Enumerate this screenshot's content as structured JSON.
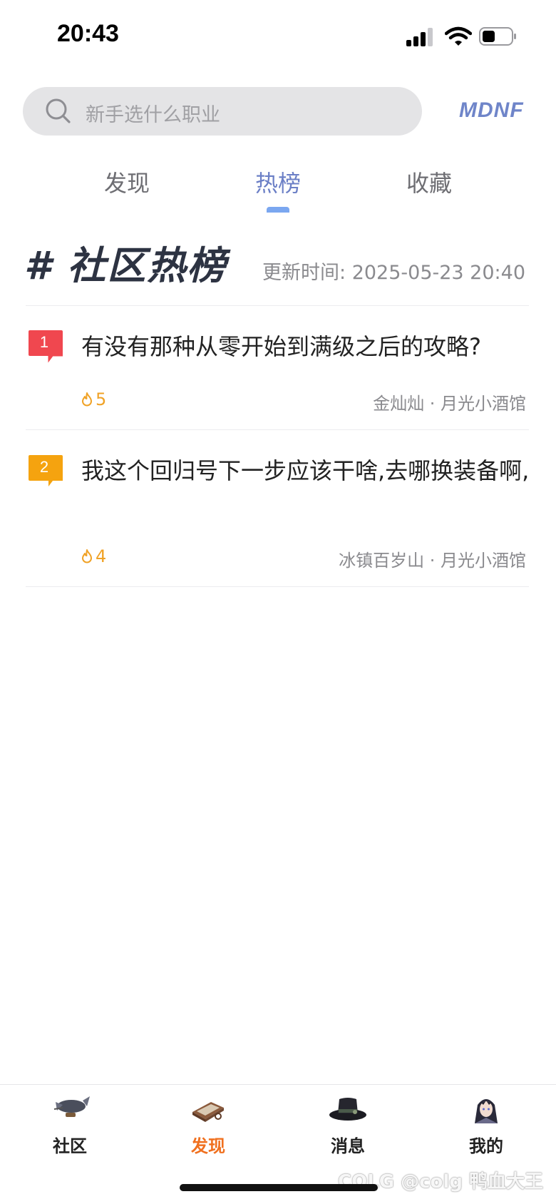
{
  "status_bar": {
    "time": "20:43",
    "icons": [
      "signal-icon",
      "wifi-icon",
      "battery-icon"
    ]
  },
  "search": {
    "placeholder": "新手选什么职业",
    "icon": "search-icon"
  },
  "brand": {
    "logo_text": "MDNF"
  },
  "tabs": [
    {
      "label": "发现",
      "active": false
    },
    {
      "label": "热榜",
      "active": true
    },
    {
      "label": "收藏",
      "active": false
    }
  ],
  "hot": {
    "heading": "# 社区热榜",
    "update_label": "更新时间: ",
    "update_value": "2025-05-23 20:40"
  },
  "posts": [
    {
      "rank": "1",
      "title": "有没有那种从零开始到满级之后的攻略?",
      "heat": "5",
      "author": "金灿灿",
      "separator": " · ",
      "board": "月光小酒馆",
      "badge_color": "#f0474f"
    },
    {
      "rank": "2",
      "title": "我这个回归号下一步应该干啥,去哪换装备啊,",
      "heat": "4",
      "author": "冰镇百岁山",
      "separator": " · ",
      "board": "月光小酒馆",
      "badge_color": "#f5a30f"
    }
  ],
  "colors": {
    "accent_tab": "#6b7fc6",
    "tab_indicator": "#7ba7f0",
    "heat": "#f0a226",
    "nav_active": "#f0701f"
  },
  "bottom_nav": [
    {
      "label": "社区",
      "icon": "airship-icon",
      "active": false
    },
    {
      "label": "发现",
      "icon": "book-icon",
      "active": true
    },
    {
      "label": "消息",
      "icon": "top-hat-icon",
      "active": false
    },
    {
      "label": "我的",
      "icon": "avatar-icon",
      "active": false
    }
  ],
  "watermark": "COLG @colg 鸭血大王"
}
